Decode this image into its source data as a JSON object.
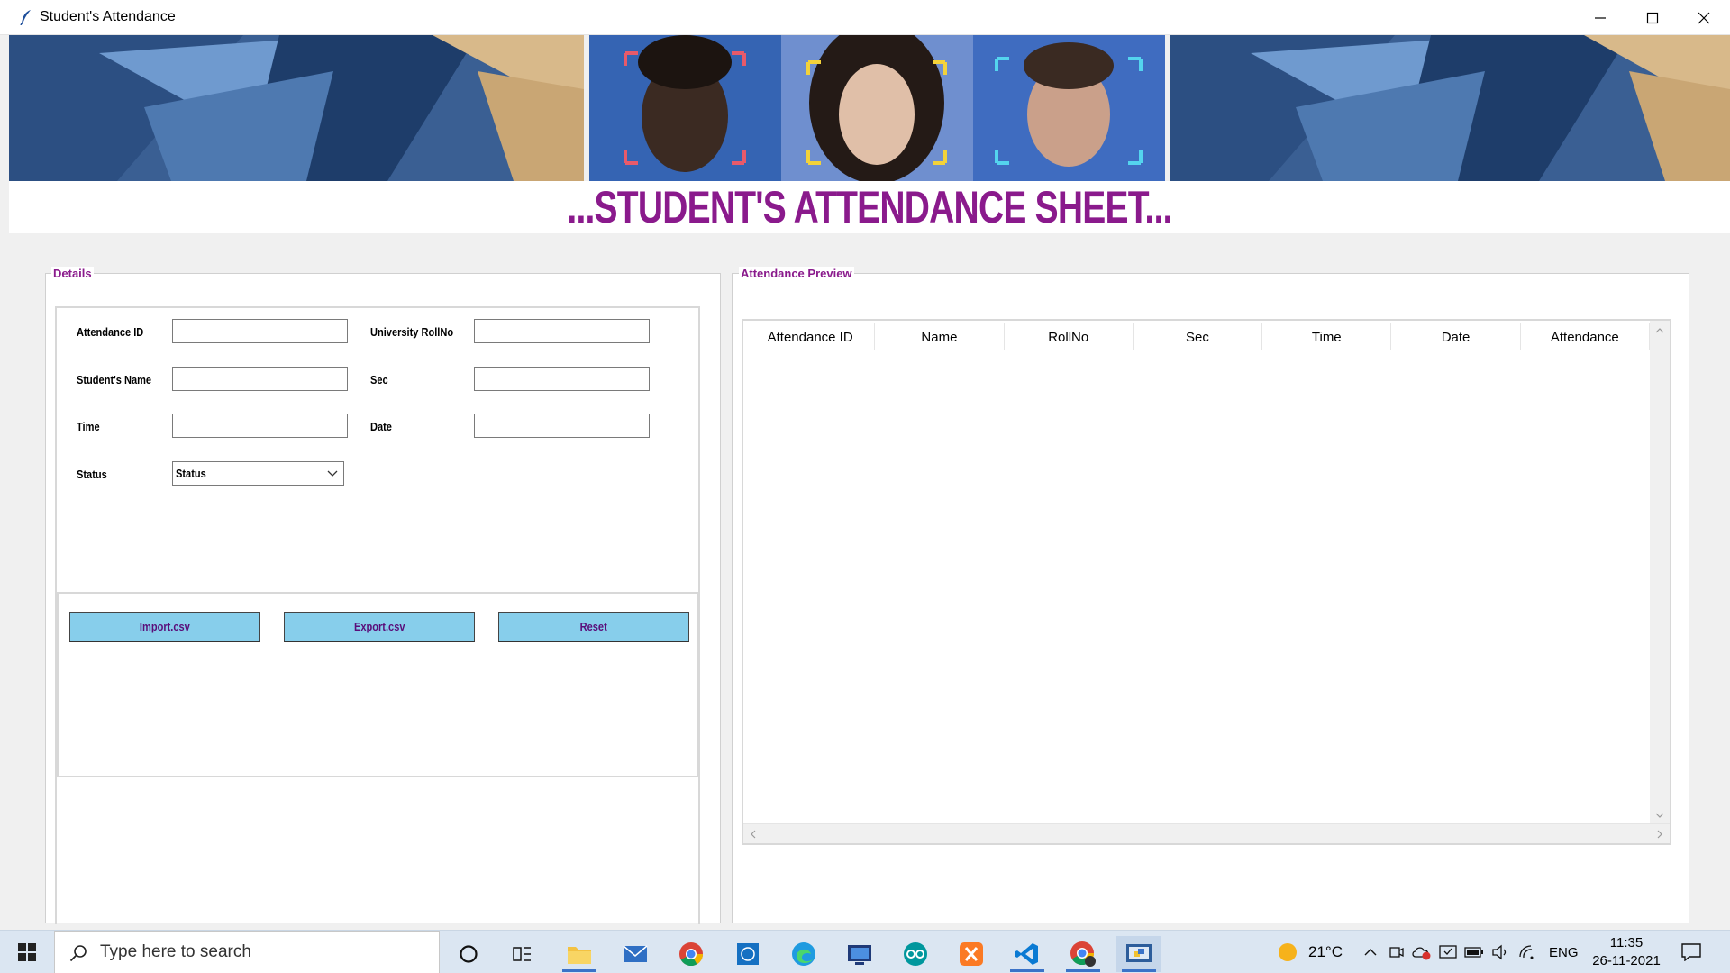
{
  "window": {
    "title": "Student's Attendance",
    "controls": [
      "minimize-icon",
      "maximize-icon",
      "close-icon"
    ]
  },
  "banner": {
    "heading": "...STUDENT'S ATTENDANCE SHEET..."
  },
  "details": {
    "legend": "Details",
    "fields": {
      "attendance_id": {
        "label": "Attendance ID",
        "value": ""
      },
      "university_rollno": {
        "label": "University RollNo",
        "value": ""
      },
      "student_name": {
        "label": "Student's Name",
        "value": ""
      },
      "sec": {
        "label": "Sec",
        "value": ""
      },
      "time": {
        "label": "Time",
        "value": ""
      },
      "date": {
        "label": "Date",
        "value": ""
      },
      "status": {
        "label": "Status",
        "selected": "Status"
      }
    },
    "buttons": {
      "import": "Import.csv",
      "export": "Export.csv",
      "reset": "Reset"
    }
  },
  "preview": {
    "legend": "Attendance Preview",
    "columns": [
      "Attendance ID",
      "Name",
      "RollNo",
      "Sec",
      "Time",
      "Date",
      "Attendance"
    ],
    "rows": []
  },
  "taskbar": {
    "search_placeholder": "Type here to search",
    "weather": "21°C",
    "language": "ENG",
    "time": "11:35",
    "date": "26-11-2021",
    "colors": {
      "accent": "#3b73c8",
      "heading": "#8a1a8c",
      "button": "#87ceeb"
    }
  }
}
